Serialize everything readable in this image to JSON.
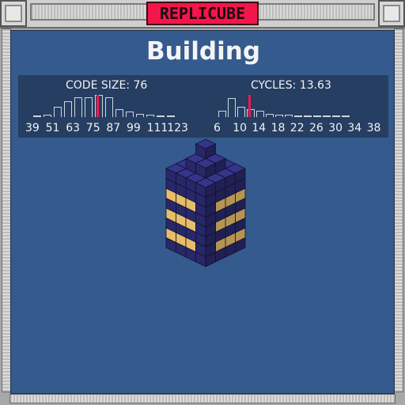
{
  "app": {
    "logo_text": "REPLICUBE"
  },
  "panel": {
    "title": "Building"
  },
  "code_size": {
    "label": "CODE SIZE: 76",
    "value": 76,
    "tick_labels": [
      "39",
      "51",
      "63",
      "75",
      "87",
      "99",
      "111",
      "123"
    ],
    "histogram": [
      0,
      0.1,
      0.45,
      0.7,
      0.9,
      0.9,
      1.0,
      0.9,
      0.35,
      0.25,
      0.15,
      0.1,
      0.05,
      0.05
    ],
    "marker_bin": 6
  },
  "cycles": {
    "label": "CYCLES: 13.63",
    "value": 13.63,
    "tick_labels": [
      "6",
      "10",
      "14",
      "18",
      "22",
      "26",
      "30",
      "34",
      "38"
    ],
    "histogram": [
      0.3,
      0.85,
      0.45,
      0.35,
      0.3,
      0.15,
      0.1,
      0.1,
      0.05,
      0.05,
      0.05,
      0.05,
      0.05,
      0.05
    ],
    "marker_bin": 3
  },
  "colors": {
    "panel_bg": "#355a8e",
    "stats_bg": "#253e62",
    "marker": "#f21a4c",
    "logo_bg": "#f2164a",
    "cube_dark": "#2a2a6e",
    "cube_light": "#f3c76e"
  }
}
